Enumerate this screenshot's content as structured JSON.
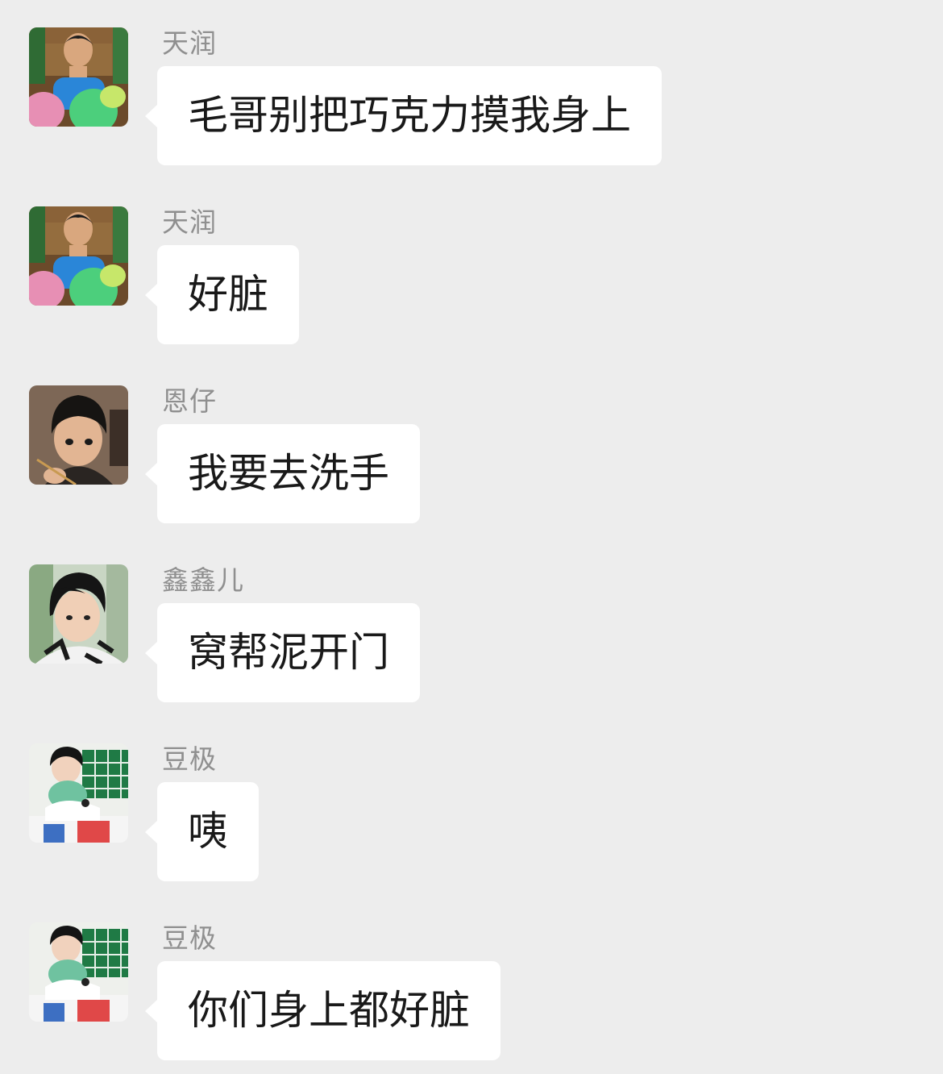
{
  "messages": [
    {
      "sender": "天润",
      "text": "毛哥别把巧克力摸我身上",
      "avatar": "avatar-boy-balloons"
    },
    {
      "sender": "天润",
      "text": "好脏",
      "avatar": "avatar-boy-balloons"
    },
    {
      "sender": "恩仔",
      "text": "我要去洗手",
      "avatar": "avatar-boy-pencil"
    },
    {
      "sender": "鑫鑫儿",
      "text": "窝帮泥开门",
      "avatar": "avatar-boy-scarf"
    },
    {
      "sender": "豆极",
      "text": "咦",
      "avatar": "avatar-boy-plush"
    },
    {
      "sender": "豆极",
      "text": "你们身上都好脏",
      "avatar": "avatar-boy-plush"
    }
  ]
}
